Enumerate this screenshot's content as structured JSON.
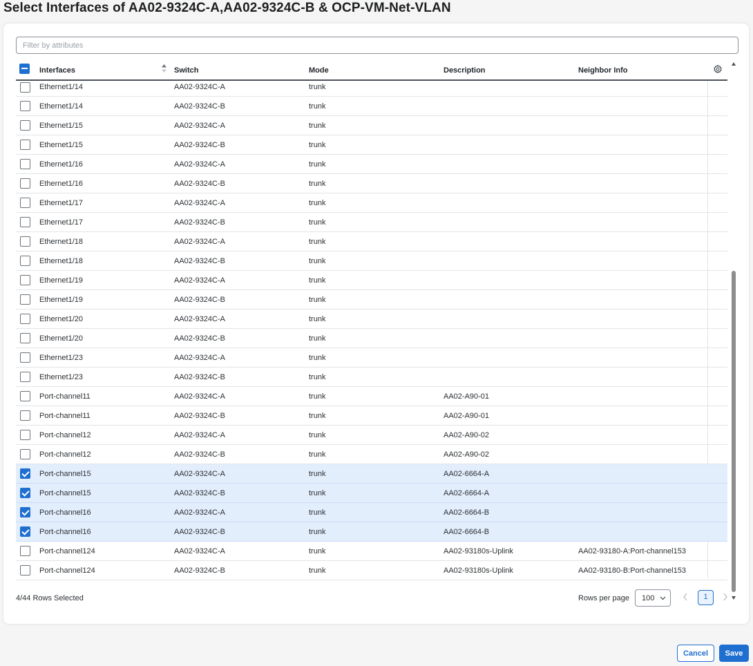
{
  "dialog": {
    "title": "Select Interfaces of AA02-9324C-A,AA02-9324C-B & OCP-VM-Net-VLAN"
  },
  "filter": {
    "placeholder": "Filter by attributes",
    "value": ""
  },
  "table": {
    "columns": {
      "interfaces": "Interfaces",
      "switch": "Switch",
      "mode": "Mode",
      "description": "Description",
      "neighbor": "Neighbor Info"
    },
    "header_checkbox_state": "indeterminate",
    "rows": [
      {
        "interface": "Ethernet1/14",
        "switch": "AA02-9324C-A",
        "mode": "trunk",
        "description": "",
        "neighbor": "",
        "selected": false
      },
      {
        "interface": "Ethernet1/14",
        "switch": "AA02-9324C-B",
        "mode": "trunk",
        "description": "",
        "neighbor": "",
        "selected": false
      },
      {
        "interface": "Ethernet1/15",
        "switch": "AA02-9324C-A",
        "mode": "trunk",
        "description": "",
        "neighbor": "",
        "selected": false
      },
      {
        "interface": "Ethernet1/15",
        "switch": "AA02-9324C-B",
        "mode": "trunk",
        "description": "",
        "neighbor": "",
        "selected": false
      },
      {
        "interface": "Ethernet1/16",
        "switch": "AA02-9324C-A",
        "mode": "trunk",
        "description": "",
        "neighbor": "",
        "selected": false
      },
      {
        "interface": "Ethernet1/16",
        "switch": "AA02-9324C-B",
        "mode": "trunk",
        "description": "",
        "neighbor": "",
        "selected": false
      },
      {
        "interface": "Ethernet1/17",
        "switch": "AA02-9324C-A",
        "mode": "trunk",
        "description": "",
        "neighbor": "",
        "selected": false
      },
      {
        "interface": "Ethernet1/17",
        "switch": "AA02-9324C-B",
        "mode": "trunk",
        "description": "",
        "neighbor": "",
        "selected": false
      },
      {
        "interface": "Ethernet1/18",
        "switch": "AA02-9324C-A",
        "mode": "trunk",
        "description": "",
        "neighbor": "",
        "selected": false
      },
      {
        "interface": "Ethernet1/18",
        "switch": "AA02-9324C-B",
        "mode": "trunk",
        "description": "",
        "neighbor": "",
        "selected": false
      },
      {
        "interface": "Ethernet1/19",
        "switch": "AA02-9324C-A",
        "mode": "trunk",
        "description": "",
        "neighbor": "",
        "selected": false
      },
      {
        "interface": "Ethernet1/19",
        "switch": "AA02-9324C-B",
        "mode": "trunk",
        "description": "",
        "neighbor": "",
        "selected": false
      },
      {
        "interface": "Ethernet1/20",
        "switch": "AA02-9324C-A",
        "mode": "trunk",
        "description": "",
        "neighbor": "",
        "selected": false
      },
      {
        "interface": "Ethernet1/20",
        "switch": "AA02-9324C-B",
        "mode": "trunk",
        "description": "",
        "neighbor": "",
        "selected": false
      },
      {
        "interface": "Ethernet1/23",
        "switch": "AA02-9324C-A",
        "mode": "trunk",
        "description": "",
        "neighbor": "",
        "selected": false
      },
      {
        "interface": "Ethernet1/23",
        "switch": "AA02-9324C-B",
        "mode": "trunk",
        "description": "",
        "neighbor": "",
        "selected": false
      },
      {
        "interface": "Port-channel11",
        "switch": "AA02-9324C-A",
        "mode": "trunk",
        "description": "AA02-A90-01",
        "neighbor": "",
        "selected": false
      },
      {
        "interface": "Port-channel11",
        "switch": "AA02-9324C-B",
        "mode": "trunk",
        "description": "AA02-A90-01",
        "neighbor": "",
        "selected": false
      },
      {
        "interface": "Port-channel12",
        "switch": "AA02-9324C-A",
        "mode": "trunk",
        "description": "AA02-A90-02",
        "neighbor": "",
        "selected": false
      },
      {
        "interface": "Port-channel12",
        "switch": "AA02-9324C-B",
        "mode": "trunk",
        "description": "AA02-A90-02",
        "neighbor": "",
        "selected": false
      },
      {
        "interface": "Port-channel15",
        "switch": "AA02-9324C-A",
        "mode": "trunk",
        "description": "AA02-6664-A",
        "neighbor": "",
        "selected": true
      },
      {
        "interface": "Port-channel15",
        "switch": "AA02-9324C-B",
        "mode": "trunk",
        "description": "AA02-6664-A",
        "neighbor": "",
        "selected": true
      },
      {
        "interface": "Port-channel16",
        "switch": "AA02-9324C-A",
        "mode": "trunk",
        "description": "AA02-6664-B",
        "neighbor": "",
        "selected": true
      },
      {
        "interface": "Port-channel16",
        "switch": "AA02-9324C-B",
        "mode": "trunk",
        "description": "AA02-6664-B",
        "neighbor": "",
        "selected": true
      },
      {
        "interface": "Port-channel124",
        "switch": "AA02-9324C-A",
        "mode": "trunk",
        "description": "AA02-93180s-Uplink",
        "neighbor": "AA02-93180-A:Port-channel153",
        "selected": false
      },
      {
        "interface": "Port-channel124",
        "switch": "AA02-9324C-B",
        "mode": "trunk",
        "description": "AA02-93180s-Uplink",
        "neighbor": "AA02-93180-B:Port-channel153",
        "selected": false
      }
    ]
  },
  "footer": {
    "selection_summary": "4/44 Rows Selected",
    "rows_per_page_label": "Rows per page",
    "rows_per_page_value": "100",
    "current_page": "1"
  },
  "actions": {
    "cancel_label": "Cancel",
    "save_label": "Save"
  },
  "colors": {
    "accent": "#1f6fd1",
    "selected_row": "#e3eefc",
    "background": "#f5f5f5"
  },
  "icons": [
    "sort-icon",
    "gear-icon",
    "chevron-down-icon",
    "chevron-left-icon",
    "chevron-right-icon",
    "scroll-up-arrow",
    "scroll-down-arrow"
  ]
}
